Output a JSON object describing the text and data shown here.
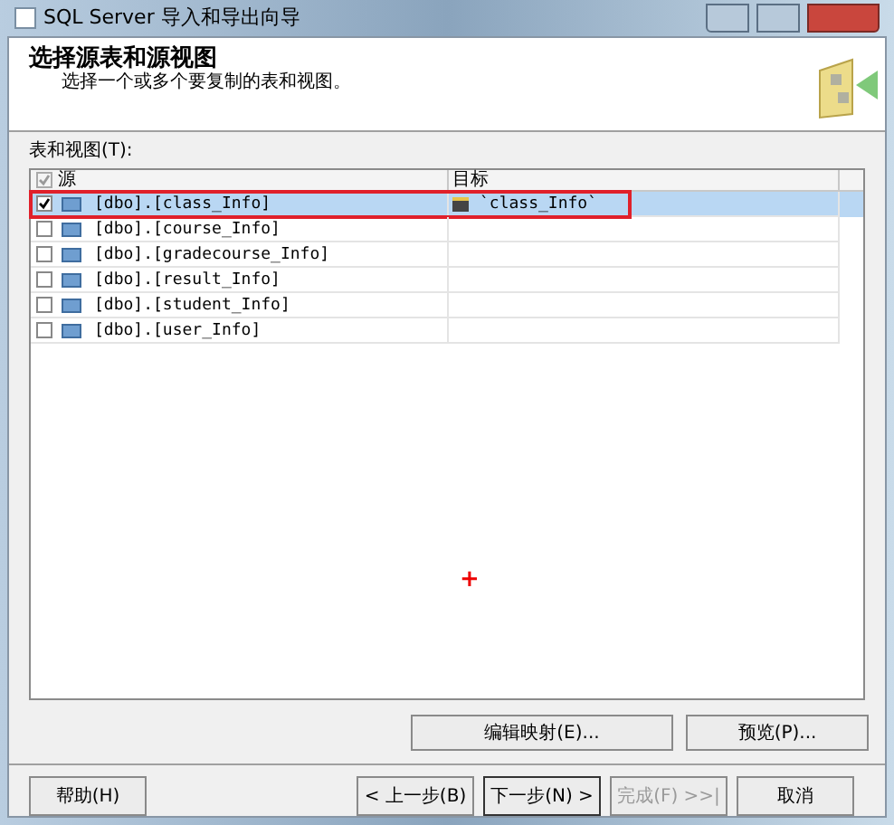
{
  "window": {
    "title": "SQL Server 导入和导出向导"
  },
  "header": {
    "title": "选择源表和源视图",
    "subtitle": "选择一个或多个要复制的表和视图。"
  },
  "table": {
    "label": "表和视图(T):",
    "header_checked": true,
    "columns": [
      "源",
      "目标"
    ],
    "rows": [
      {
        "source": "[dbo].[class_Info]",
        "target": "`class_Info`",
        "checked": true,
        "selected": true
      },
      {
        "source": "[dbo].[course_Info]",
        "checked": false,
        "selected": false
      },
      {
        "source": "[dbo].[gradecourse_Info]",
        "checked": false,
        "selected": false
      },
      {
        "source": "[dbo].[result_Info]",
        "checked": false,
        "selected": false
      },
      {
        "source": "[dbo].[student_Info]",
        "checked": false,
        "selected": false
      },
      {
        "source": "[dbo].[user_Info]",
        "checked": false,
        "selected": false
      }
    ]
  },
  "cursor_mark": "+",
  "actions": [
    {
      "label": "编辑映射(E)..."
    },
    {
      "label": "预览(P)..."
    }
  ],
  "footer": [
    {
      "label": "帮助(H)",
      "disabled": false
    },
    {
      "label": "< 上一步(B)",
      "disabled": false
    },
    {
      "label": "下一步(N) >",
      "disabled": false
    },
    {
      "label": "完成(F) >>|",
      "disabled": true
    },
    {
      "label": "取消",
      "disabled": false
    }
  ]
}
